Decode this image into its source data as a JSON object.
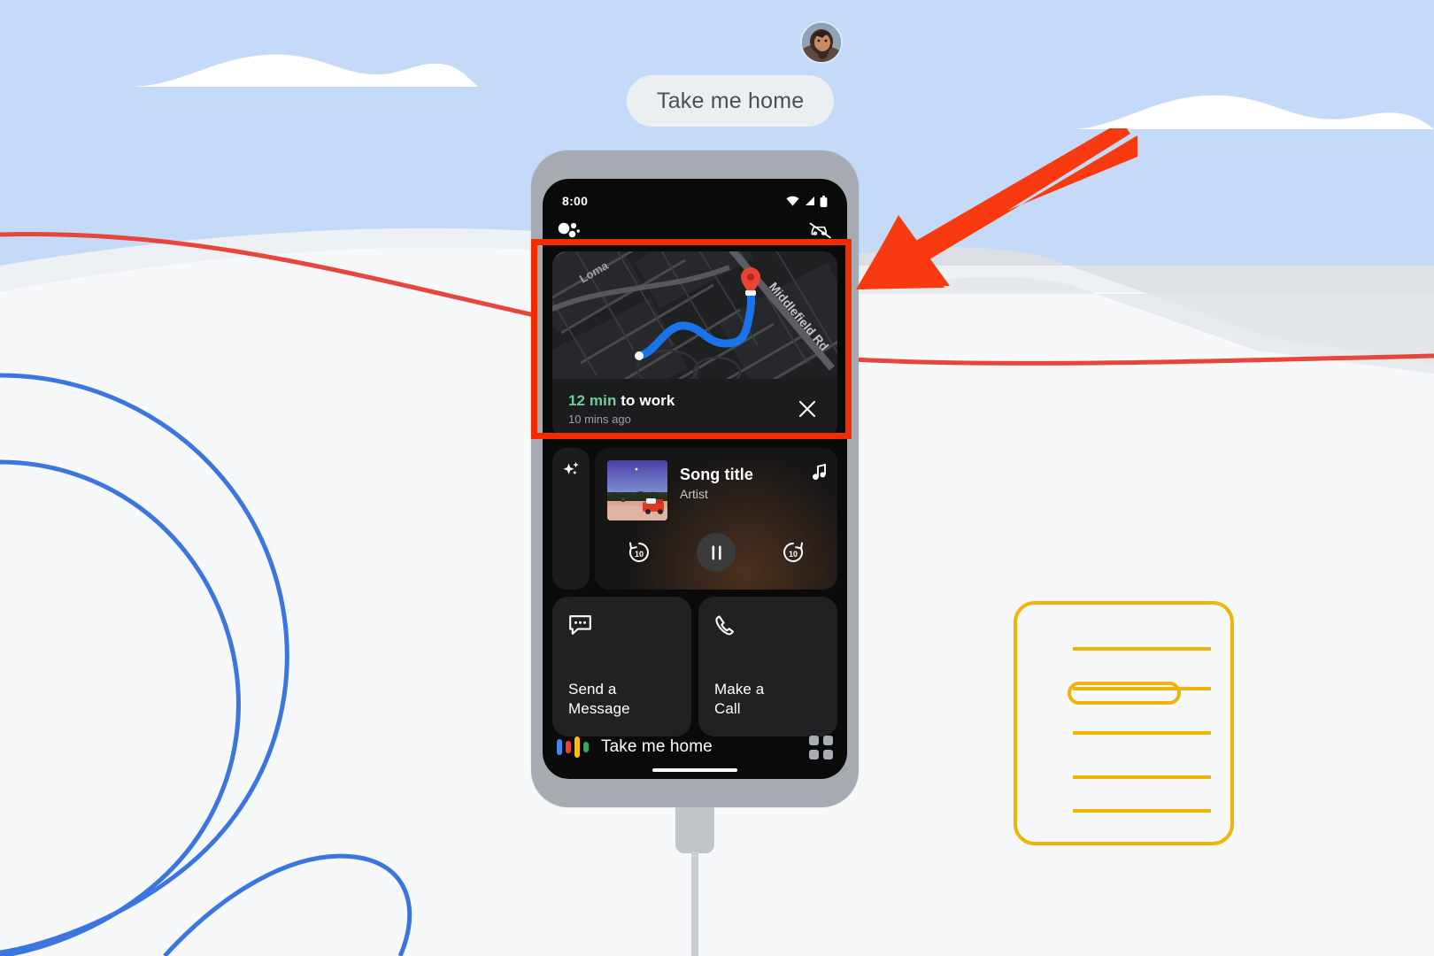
{
  "colors": {
    "sky": "#c5daf8",
    "ground": "#f4f6f8",
    "red_line": "#e8453c",
    "blue_line": "#3a75e0",
    "yellow_note": "#f2b307",
    "highlight": "#f22c00",
    "arrow": "#f93a10",
    "accent_green": "#6fcf97",
    "assistant_blue": "#4285f4",
    "assistant_red": "#ea4335",
    "assistant_yellow": "#fbbc05",
    "assistant_green": "#34a853"
  },
  "overlay": {
    "utterance": "Take me home",
    "avatar_name": "user-avatar",
    "arrow_name": "annotation-arrow",
    "highlight_name": "annotation-highlight-rect"
  },
  "phone": {
    "status_bar": {
      "time": "8:00",
      "icons": [
        "wifi-icon",
        "cellular-signal-icon",
        "battery-icon"
      ]
    },
    "app_bar": {
      "left_icon": "google-assistant-icon",
      "right_icon": "driving-mode-off-icon"
    },
    "map_card": {
      "street_label_1": "Loma",
      "street_label_2": "Middlefield Rd",
      "eta_value": "12 min",
      "eta_destination": "to work",
      "timestamp": "10 mins ago",
      "close_icon": "close-icon",
      "pin_icon": "map-pin-icon"
    },
    "media": {
      "side_icon": "sparkle-icon",
      "note_icon": "music-note-icon",
      "title": "Song title",
      "artist": "Artist",
      "rewind_label": "10",
      "forward_label": "10",
      "rewind_icon": "rewind-10-icon",
      "play_pause_icon": "pause-icon",
      "forward_icon": "forward-10-icon",
      "album_art_name": "album-art"
    },
    "tiles": [
      {
        "icon": "message-bubble-icon",
        "label": "Send a\nMessage",
        "line1": "Send a",
        "line2": "Message"
      },
      {
        "icon": "phone-call-icon",
        "label": "Make a\nCall",
        "line1": "Make a",
        "line2": "Call"
      }
    ],
    "bottom_bar": {
      "assistant_icon": "google-assistant-bars-icon",
      "label": "Take me home",
      "apps_icon": "apps-grid-icon"
    }
  }
}
